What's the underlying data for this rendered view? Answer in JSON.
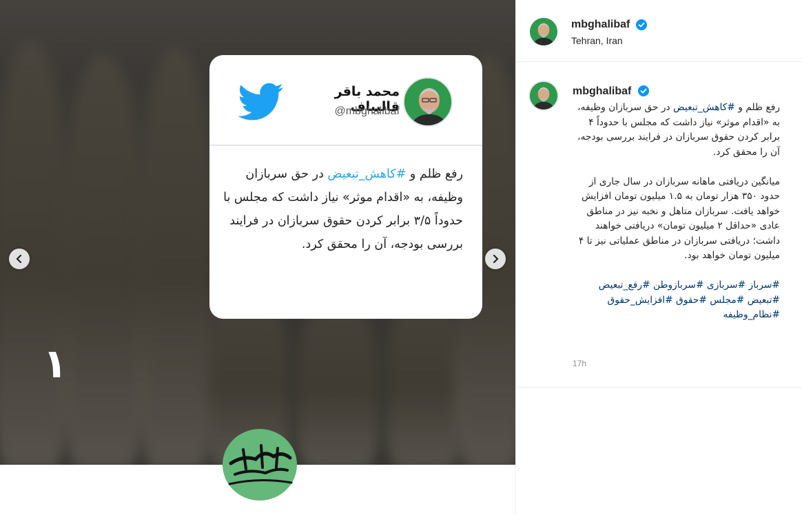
{
  "post": {
    "username": "mbghalibaf",
    "location": "Tehran, Iran",
    "timestamp": "17h",
    "caption": {
      "p1_before": "رفع ظلم و ",
      "p1_hashtag": "#کاهش_تبعیض",
      "p1_after": " در حق سربازان وظیفه، به «اقدام موثر» نیاز داشت که مجلس با حدوداً ۴ برابر کردن حقوق سربازان در فرایند بررسی بودجه، آن را محقق کرد.",
      "p2": "میانگین دریافتی ماهانه سربازان در سال جاری از حدود ۳۵۰ هزار تومان به ۱.۵ میلیون تومان افزایش خواهد یافت. سربازان متاهل و نخبه نیز در مناطق عادی «حداقل ۲ میلیون تومان» دریافتی خواهند داشت؛ دریافتی سربازان در مناطق عملیاتی نیز تا ۴ میلیون تومان خواهد بود.",
      "hashtags": "#سرباز #سربازی #سربازوطن #رفع_تبعیض #تبعیض #مجلس #حقوق #افزایش_حقوق #نظام_وظیفه"
    }
  },
  "card": {
    "name": "محمد باقر قالیباف",
    "handle": "@mbghalibaf",
    "text_before": "رفع ظلم و ",
    "text_hashtag": "#کاهش_تبعیض",
    "text_after": " در حق سربازان وظیفه، به «اقدام موثر» نیاز داشت که مجلس با حدوداً ۳/۵ برابر کردن حقوق سربازان در فرایند بررسی بودجه، آن را محقق کرد."
  },
  "slide": {
    "number": "۱"
  },
  "colors": {
    "link": "#00376b",
    "hashtag_card": "#2ea2dc",
    "twitter": "#1da1f2",
    "verified": "#0095f6",
    "seal": "#65b77a"
  },
  "icons": {
    "prev": "chevron-left-icon",
    "next": "chevron-right-icon",
    "verified": "verified-badge-icon",
    "twitter": "twitter-bird-icon"
  }
}
